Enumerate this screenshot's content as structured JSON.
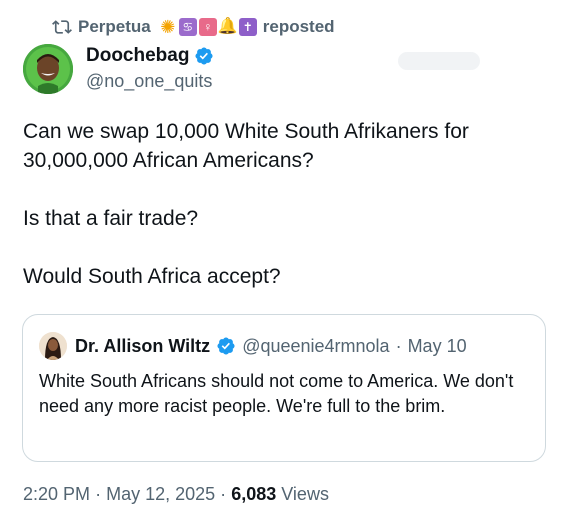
{
  "repost": {
    "user": "Perpetua",
    "label": "reposted",
    "emojis": [
      "sun",
      "cancer",
      "child",
      "bell",
      "latin-cross"
    ]
  },
  "author": {
    "display_name": "Doochebag",
    "handle": "@no_one_quits",
    "verified": true
  },
  "tweet": {
    "paragraphs": [
      "Can we swap 10,000 White South Afrikaners for 30,000,000 African Americans?",
      "Is that a fair trade?",
      "Would South Africa accept?"
    ]
  },
  "quoted": {
    "display_name": "Dr. Allison Wiltz",
    "handle": "@queenie4rmnola",
    "separator": "·",
    "date": "May 10",
    "text": "White South Africans should not come to America. We don't need any more racist people. We're full to the brim."
  },
  "meta": {
    "time": "2:20 PM",
    "separator": "·",
    "date": "May 12, 2025",
    "views_count": "6,083",
    "views_label": "Views"
  },
  "colors": {
    "text_primary": "#0f1419",
    "text_secondary": "#536471",
    "verified_blue": "#1d9bf0",
    "border": "#cfd9de"
  }
}
